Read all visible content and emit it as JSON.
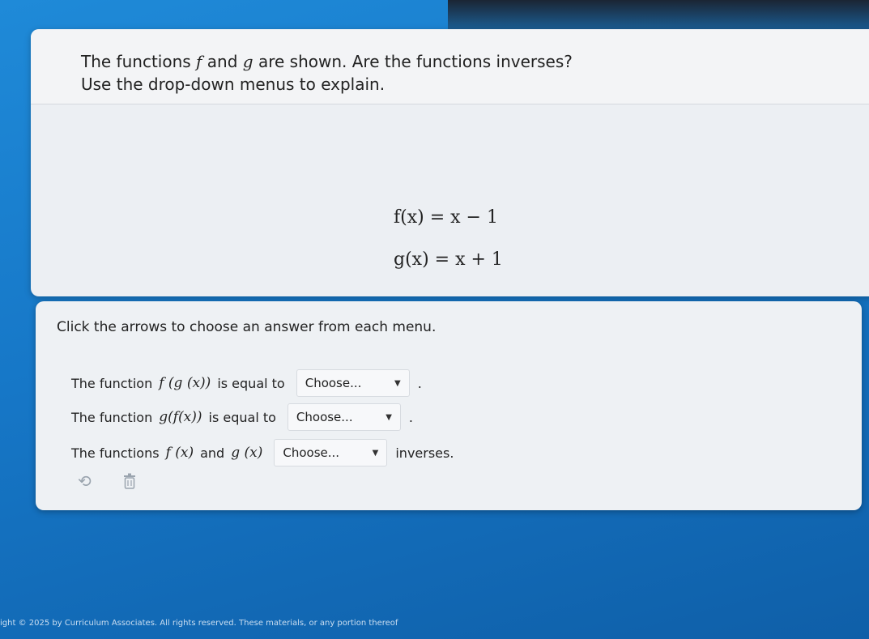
{
  "question": {
    "line1_prefix": "The functions ",
    "f": "f",
    "and": " and ",
    "g": "g",
    "line1_suffix": " are shown. Are the functions inverses?",
    "line2": "Use the drop-down menus to explain."
  },
  "equations": {
    "f": "f(x) = x − 1",
    "g": "g(x) = x + 1"
  },
  "answer": {
    "instruction": "Click the arrows to choose an answer from each menu.",
    "row1": {
      "prefix": "The function",
      "expr": "f (g (x))",
      "middle": "is equal to",
      "dropdown_value": "Choose...",
      "suffix": "."
    },
    "row2": {
      "prefix": "The function",
      "expr": "g(f(x))",
      "middle": "is equal to",
      "dropdown_value": "Choose...",
      "suffix": "."
    },
    "row3": {
      "prefix": "The functions",
      "expr1": "f (x)",
      "and": "and",
      "expr2": "g (x)",
      "dropdown_value": "Choose...",
      "suffix": "inverses."
    }
  },
  "icons": {
    "undo": "undo-icon",
    "trash": "trash-icon"
  },
  "footer": "ight © 2025 by Curriculum Associates. All rights reserved. These materials, or any portion thereof"
}
